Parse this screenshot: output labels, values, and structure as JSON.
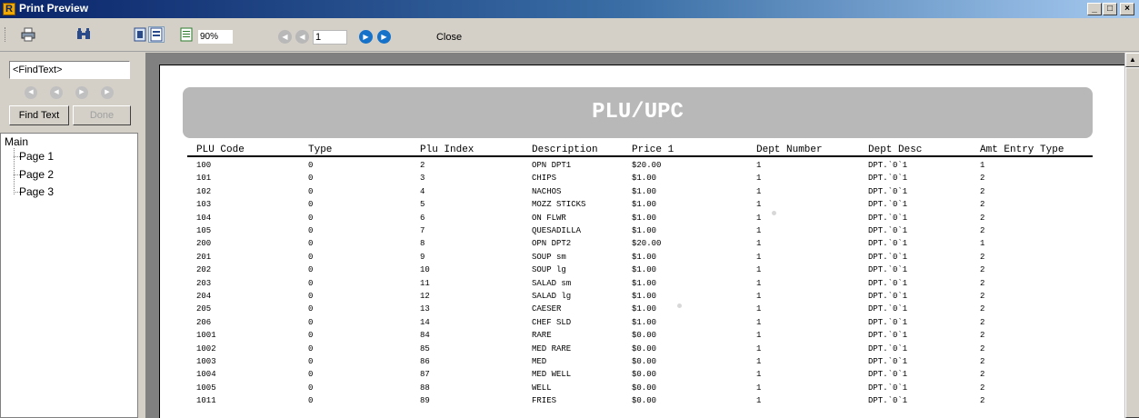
{
  "window": {
    "title": "Print Preview",
    "icon": "report-app-icon",
    "controls": [
      "minimize",
      "maximize",
      "close"
    ]
  },
  "toolbar": {
    "icons": [
      "print-icon",
      "find-icon",
      "single-page-icon",
      "page-view-icon",
      "multi-page-icon"
    ],
    "zoom": "90%",
    "page_number": "1",
    "close_label": "Close"
  },
  "find_panel": {
    "placeholder": "<FindText>",
    "find_label": "Find Text",
    "done_label": "Done",
    "nav_icons": [
      "first-icon",
      "prev-icon",
      "next-icon",
      "last-icon"
    ]
  },
  "tree": {
    "root": "Main",
    "pages": [
      "Page 1",
      "Page 2",
      "Page 3"
    ]
  },
  "report": {
    "title": "PLU/UPC",
    "columns": [
      "PLU Code",
      "Type",
      "Plu Index",
      "Description",
      "Price 1",
      "Dept Number",
      "Dept Desc",
      "Amt Entry Type"
    ],
    "rows": [
      [
        "100",
        "0",
        "2",
        "OPN DPT1",
        "$20.00",
        "1",
        "DPT.`0`1",
        "1"
      ],
      [
        "101",
        "0",
        "3",
        "CHIPS",
        "$1.00",
        "1",
        "DPT.`0`1",
        "2"
      ],
      [
        "102",
        "0",
        "4",
        "NACHOS",
        "$1.00",
        "1",
        "DPT.`0`1",
        "2"
      ],
      [
        "103",
        "0",
        "5",
        "MOZZ STICKS",
        "$1.00",
        "1",
        "DPT.`0`1",
        "2"
      ],
      [
        "104",
        "0",
        "6",
        "ON FLWR",
        "$1.00",
        "1",
        "DPT.`0`1",
        "2"
      ],
      [
        "105",
        "0",
        "7",
        "QUESADILLA",
        "$1.00",
        "1",
        "DPT.`0`1",
        "2"
      ],
      [
        "200",
        "0",
        "8",
        "OPN DPT2",
        "$20.00",
        "1",
        "DPT.`0`1",
        "1"
      ],
      [
        "201",
        "0",
        "9",
        "SOUP sm",
        "$1.00",
        "1",
        "DPT.`0`1",
        "2"
      ],
      [
        "202",
        "0",
        "10",
        "SOUP lg",
        "$1.00",
        "1",
        "DPT.`0`1",
        "2"
      ],
      [
        "203",
        "0",
        "11",
        "SALAD sm",
        "$1.00",
        "1",
        "DPT.`0`1",
        "2"
      ],
      [
        "204",
        "0",
        "12",
        "SALAD lg",
        "$1.00",
        "1",
        "DPT.`0`1",
        "2"
      ],
      [
        "205",
        "0",
        "13",
        "CAESER",
        "$1.00",
        "1",
        "DPT.`0`1",
        "2"
      ],
      [
        "206",
        "0",
        "14",
        "CHEF SLD",
        "$1.00",
        "1",
        "DPT.`0`1",
        "2"
      ],
      [
        "1001",
        "0",
        "84",
        "RARE",
        "$0.00",
        "1",
        "DPT.`0`1",
        "2"
      ],
      [
        "1002",
        "0",
        "85",
        "MED RARE",
        "$0.00",
        "1",
        "DPT.`0`1",
        "2"
      ],
      [
        "1003",
        "0",
        "86",
        "MED",
        "$0.00",
        "1",
        "DPT.`0`1",
        "2"
      ],
      [
        "1004",
        "0",
        "87",
        "MED WELL",
        "$0.00",
        "1",
        "DPT.`0`1",
        "2"
      ],
      [
        "1005",
        "0",
        "88",
        "WELL",
        "$0.00",
        "1",
        "DPT.`0`1",
        "2"
      ],
      [
        "1011",
        "0",
        "89",
        "FRIES",
        "$0.00",
        "1",
        "DPT.`0`1",
        "2"
      ]
    ]
  },
  "colors": {
    "titlebar_start": "#0a246a",
    "titlebar_end": "#a6caf0",
    "header_band": "#b8b8b8",
    "nav_active": "#1672c9"
  }
}
